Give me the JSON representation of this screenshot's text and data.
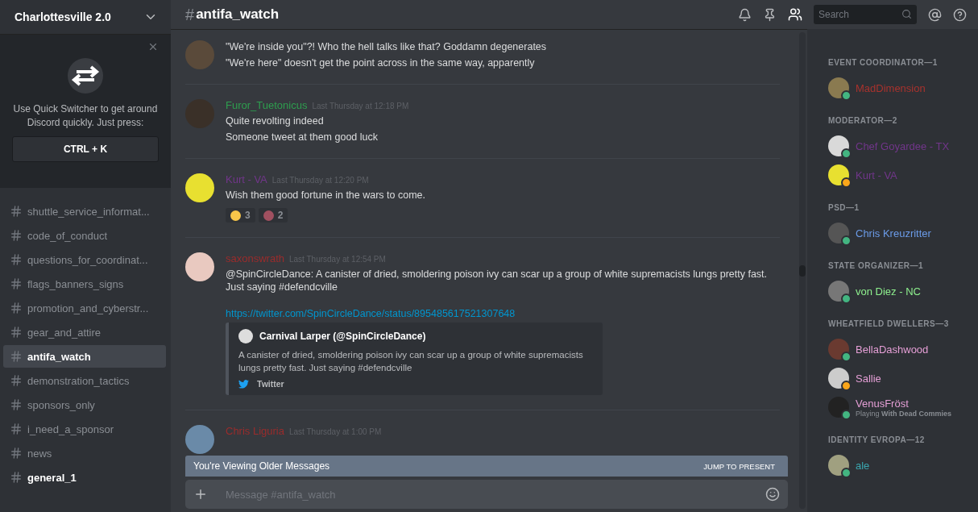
{
  "server": {
    "name": "Charlottesville 2.0"
  },
  "quick_switcher": {
    "text": "Use Quick Switcher to get around Discord quickly. Just press:",
    "shortcut": "CTRL + K"
  },
  "channels": [
    {
      "name": "shuttle_service_informat...",
      "selected": false,
      "unread": false
    },
    {
      "name": "code_of_conduct",
      "selected": false,
      "unread": false
    },
    {
      "name": "questions_for_coordinat...",
      "selected": false,
      "unread": false
    },
    {
      "name": "flags_banners_signs",
      "selected": false,
      "unread": false
    },
    {
      "name": "promotion_and_cyberstr...",
      "selected": false,
      "unread": false
    },
    {
      "name": "gear_and_attire",
      "selected": false,
      "unread": false
    },
    {
      "name": "antifa_watch",
      "selected": true,
      "unread": false
    },
    {
      "name": "demonstration_tactics",
      "selected": false,
      "unread": false
    },
    {
      "name": "sponsors_only",
      "selected": false,
      "unread": false
    },
    {
      "name": "i_need_a_sponsor",
      "selected": false,
      "unread": false
    },
    {
      "name": "news",
      "selected": false,
      "unread": false
    },
    {
      "name": "general_1",
      "selected": false,
      "unread": true
    }
  ],
  "header": {
    "hash": "#",
    "channel": "antifa_watch",
    "search_placeholder": "Search"
  },
  "messages": [
    {
      "lines": [
        "\"We're inside you\"?! Who the hell talks like that? Goddamn degenerates",
        "\"We're here\" doesn't get the point across in the same way, apparently"
      ]
    },
    {
      "author": "Furor_Tuetonicus",
      "color": "#2e9e4f",
      "time": "Last Thursday at 12:18 PM",
      "lines": [
        "Quite revolting indeed",
        "Someone tweet at them good luck"
      ]
    },
    {
      "author": "Kurt - VA",
      "color": "#71368a",
      "time": "Last Thursday at 12:20 PM",
      "lines": [
        "Wish them good fortune in the wars to come."
      ],
      "reactions": [
        {
          "count": "3"
        },
        {
          "count": "2"
        }
      ]
    },
    {
      "author": "saxonswrath",
      "color": "#9a2c2c",
      "time": "Last Thursday at 12:54 PM",
      "lines": [
        "@SpinCircleDance: A canister of dried, smoldering poison ivy can scar up a group of white supremacists lungs pretty fast. Just saying #defendcville"
      ],
      "link": "https://twitter.com/SpinCircleDance/status/895485617521307648",
      "embed": {
        "author": "Carnival Larper (@SpinCircleDance)",
        "text": "A canister of dried, smoldering poison ivy can scar up a group of white supremacists lungs pretty fast. Just saying #defendcville",
        "footer": "Twitter"
      }
    },
    {
      "author": "Chris Liguria",
      "color": "#9a2c2c",
      "time": "Last Thursday at 1:00 PM"
    }
  ],
  "older_banner": {
    "text": "You're Viewing Older Messages",
    "action": "JUMP TO PRESENT"
  },
  "composer": {
    "placeholder": "Message #antifa_watch"
  },
  "member_groups": [
    {
      "title": "EVENT COORDINATOR—1",
      "members": [
        {
          "name": "MadDimension",
          "color": "#a8322d",
          "idle": false
        }
      ]
    },
    {
      "title": "MODERATOR—2",
      "members": [
        {
          "name": "Chef Goyardee - TX",
          "color": "#71368a",
          "idle": false
        },
        {
          "name": "Kurt - VA",
          "color": "#71368a",
          "idle": true
        }
      ]
    },
    {
      "title": "PSD—1",
      "members": [
        {
          "name": "Chris Kreuzritter",
          "color": "#6b9be8",
          "idle": false
        }
      ]
    },
    {
      "title": "STATE ORGANIZER—1",
      "members": [
        {
          "name": "von Diez - NC",
          "color": "#8ef08e",
          "idle": false
        }
      ]
    },
    {
      "title": "WHEATFIELD DWELLERS—3",
      "members": [
        {
          "name": "BellaDashwood",
          "color": "#e59fd6",
          "idle": false
        },
        {
          "name": "Sallie",
          "color": "#e59fd6",
          "idle": true
        },
        {
          "name": "VenusFröst",
          "color": "#e59fd6",
          "idle": false,
          "activity": "Playing **With Dead Commies**"
        }
      ]
    },
    {
      "title": "IDENTITY EVROPA—12",
      "members": [
        {
          "name": "ale",
          "color": "#3aa7b0",
          "idle": false
        }
      ]
    }
  ]
}
